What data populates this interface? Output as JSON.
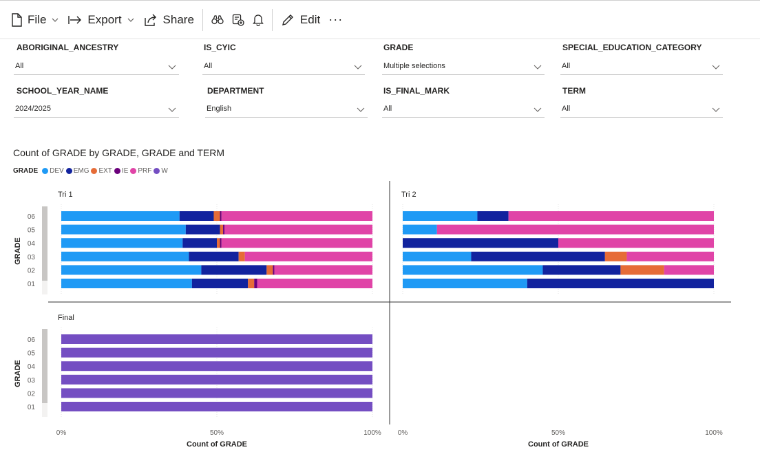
{
  "toolbar": {
    "file_label": "File",
    "export_label": "Export",
    "share_label": "Share",
    "edit_label": "Edit",
    "more_label": "···"
  },
  "filters": [
    {
      "label": "ABORIGINAL_ANCESTRY",
      "value": "All"
    },
    {
      "label": "IS_CYIC",
      "value": "All"
    },
    {
      "label": "GRADE",
      "value": "Multiple selections"
    },
    {
      "label": "SPECIAL_EDUCATION_CATEGORY",
      "value": "All"
    },
    {
      "label": "SCHOOL_YEAR_NAME",
      "value": "2024/2025"
    },
    {
      "label": "DEPARTMENT",
      "value": "English"
    },
    {
      "label": "IS_FINAL_MARK",
      "value": "All"
    },
    {
      "label": "TERM",
      "value": "All"
    }
  ],
  "chart_title": "Count of GRADE by GRADE, GRADE and TERM",
  "legend": {
    "title": "GRADE",
    "items": [
      {
        "name": "DEV",
        "color": "#1f9af5"
      },
      {
        "name": "EMG",
        "color": "#12239e"
      },
      {
        "name": "EXT",
        "color": "#e66c37"
      },
      {
        "name": "IE",
        "color": "#6b007b"
      },
      {
        "name": "PRF",
        "color": "#e044a7"
      },
      {
        "name": "W",
        "color": "#744ec2"
      }
    ]
  },
  "chart_data": {
    "type": "bar",
    "stacked": "100%",
    "orientation": "horizontal",
    "title": "Count of GRADE by GRADE, GRADE and TERM",
    "xlabel": "Count of GRADE",
    "ylabel": "GRADE",
    "xticks": [
      "0%",
      "50%",
      "100%"
    ],
    "categories": [
      "06",
      "05",
      "04",
      "03",
      "02",
      "01"
    ],
    "panels": [
      {
        "name": "Tri 1",
        "series": [
          {
            "name": "DEV",
            "values": [
              38,
              40,
              39,
              41,
              45,
              42
            ]
          },
          {
            "name": "EMG",
            "values": [
              11,
              11,
              11,
              16,
              21,
              18
            ]
          },
          {
            "name": "EXT",
            "values": [
              2,
              1,
              1,
              2,
              2,
              2
            ]
          },
          {
            "name": "IE",
            "values": [
              0.5,
              0.5,
              0.5,
              0,
              0.5,
              1
            ]
          },
          {
            "name": "PRF",
            "values": [
              48.5,
              47.5,
              48.5,
              41,
              31.5,
              37
            ]
          },
          {
            "name": "W",
            "values": [
              0,
              0,
              0,
              0,
              0,
              0
            ]
          }
        ]
      },
      {
        "name": "Tri 2",
        "series": [
          {
            "name": "DEV",
            "values": [
              24,
              11,
              0,
              22,
              45,
              40
            ]
          },
          {
            "name": "EMG",
            "values": [
              10,
              0,
              50,
              43,
              25,
              60
            ]
          },
          {
            "name": "EXT",
            "values": [
              0,
              0,
              0,
              7,
              14,
              0
            ]
          },
          {
            "name": "IE",
            "values": [
              0,
              0,
              0,
              0,
              0,
              0
            ]
          },
          {
            "name": "PRF",
            "values": [
              66,
              89,
              50,
              28,
              16,
              0
            ]
          },
          {
            "name": "W",
            "values": [
              0,
              0,
              0,
              0,
              0,
              0
            ]
          }
        ]
      },
      {
        "name": "Final",
        "series": [
          {
            "name": "DEV",
            "values": [
              0,
              0,
              0,
              0,
              0,
              0
            ]
          },
          {
            "name": "EMG",
            "values": [
              0,
              0,
              0,
              0,
              0,
              0
            ]
          },
          {
            "name": "EXT",
            "values": [
              0,
              0,
              0,
              0,
              0,
              0
            ]
          },
          {
            "name": "IE",
            "values": [
              0,
              0,
              0,
              0,
              0,
              0
            ]
          },
          {
            "name": "PRF",
            "values": [
              0,
              0,
              0,
              0,
              0,
              0
            ]
          },
          {
            "name": "W",
            "values": [
              100,
              100,
              100,
              100,
              100,
              100
            ]
          }
        ]
      }
    ]
  }
}
